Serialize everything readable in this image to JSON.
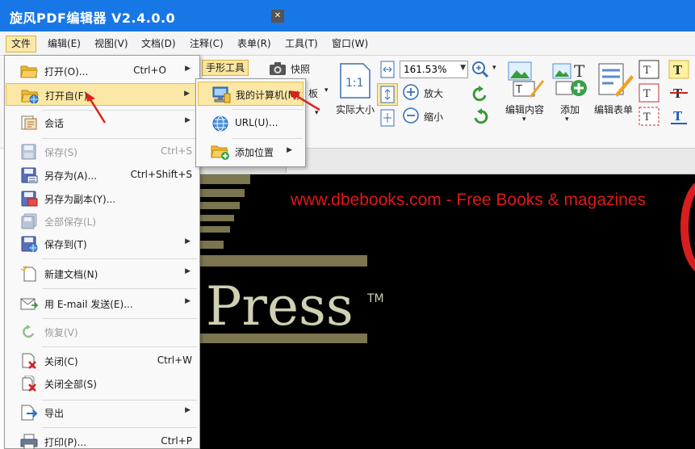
{
  "window": {
    "title": "旋风PDF编辑器 V2.4.0.0"
  },
  "menubar": {
    "items": [
      {
        "label": "文件"
      },
      {
        "label": "编辑(E)"
      },
      {
        "label": "视图(V)"
      },
      {
        "label": "文档(D)"
      },
      {
        "label": "注释(C)"
      },
      {
        "label": "表单(R)"
      },
      {
        "label": "工具(T)"
      },
      {
        "label": "窗口(W)"
      }
    ]
  },
  "ribbon": {
    "hand_tool": "手形工具",
    "snapshot": "快照",
    "panel_partial": "板",
    "actual_size": "实际大小",
    "zoom_value": "161.53%",
    "zoom_in": "放大",
    "zoom_out": "缩小",
    "edit_content": "编辑内容",
    "add": "添加",
    "edit_form": "编辑表单"
  },
  "document": {
    "tab_label": "...",
    "watermark": "www.dbebooks.com - Free Books & magazines",
    "logo_text": "Press",
    "logo_tm": "TM"
  },
  "file_menu": {
    "items": [
      {
        "label": "打开(O)...",
        "shortcut": "Ctrl+O"
      },
      {
        "label": "打开自(F)"
      },
      {
        "label": "会话"
      },
      {
        "label": "保存(S)",
        "shortcut": "Ctrl+S"
      },
      {
        "label": "另存为(A)...",
        "shortcut": "Ctrl+Shift+S"
      },
      {
        "label": "另存为副本(Y)..."
      },
      {
        "label": "全部保存(L)"
      },
      {
        "label": "保存到(T)"
      },
      {
        "label": "新建文档(N)"
      },
      {
        "label": "用 E-mail 发送(E)..."
      },
      {
        "label": "恢复(V)"
      },
      {
        "label": "关闭(C)",
        "shortcut": "Ctrl+W"
      },
      {
        "label": "关闭全部(S)"
      },
      {
        "label": "导出"
      },
      {
        "label": "打印(P)...",
        "shortcut": "Ctrl+P"
      }
    ]
  },
  "open_from_submenu": {
    "items": [
      {
        "label": "我的计算机(M)"
      },
      {
        "label": "URL(U)..."
      },
      {
        "label": "添加位置"
      }
    ]
  },
  "colors": {
    "titlebar": "#1877e6",
    "highlight": "#fbe8a6",
    "watermark_red": "#e01818",
    "arrow_red": "#e02020"
  }
}
